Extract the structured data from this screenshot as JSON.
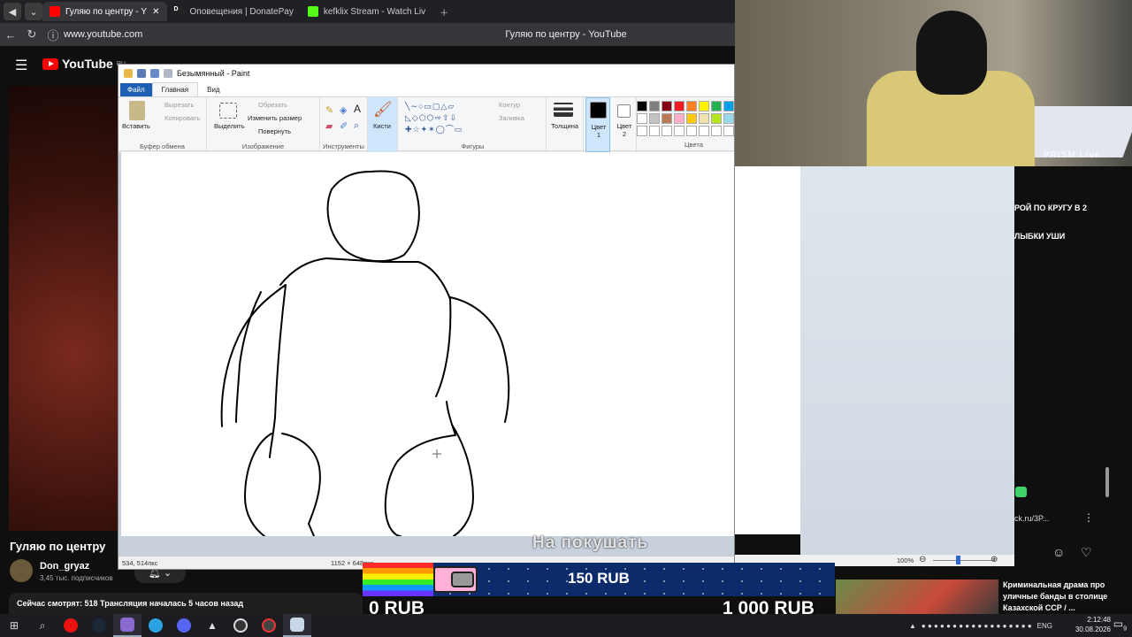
{
  "browser": {
    "tabs": [
      {
        "label": "Гуляю по центру - Y",
        "active": true
      },
      {
        "label": "Оповещения | DonatePay",
        "active": false
      },
      {
        "label": "kefklix Stream - Watch Liv",
        "active": false
      }
    ],
    "url": "www.youtube.com",
    "page_title": "Гуляю по центру - YouTube"
  },
  "youtube": {
    "logo_text": "YouTube",
    "region": "RU",
    "video_title": "Гуляю по центру",
    "channel": "Don_gryaz",
    "subscribers": "3,45 тыс. подписчиков",
    "stats_line": "Сейчас смотрят: 518  Трансляция началась 5 часов назад",
    "chat": {
      "line1": "РОЙ ПО КРУГУ В 2",
      "line2": "ЛЫБКИ УШИ",
      "link": "ck.ru/3P..."
    },
    "recommended": {
      "title": "Криминальная драма про уличные банды в столице Казахской ССР / ..."
    }
  },
  "webcam": {
    "label": "PRISM Live"
  },
  "paint": {
    "title": "Безымянный - Paint",
    "menu": {
      "file": "Файл",
      "home": "Главная",
      "view": "Вид"
    },
    "clipboard": {
      "paste": "Вставить",
      "cut": "Вырезать",
      "copy": "Копировать",
      "label": "Буфер обмена"
    },
    "image": {
      "select": "Выделить",
      "crop": "Обрезать",
      "resize": "Изменить размер",
      "rotate": "Повернуть",
      "label": "Изображение"
    },
    "tools": {
      "label": "Инструменты"
    },
    "brushes": {
      "label": "Кисти"
    },
    "shapes": {
      "outline": "Контур",
      "fill": "Заливка",
      "label": "Фигуры"
    },
    "size": {
      "label": "Толщина"
    },
    "color1": {
      "label": "Цвет 1"
    },
    "color2": {
      "label": "Цвет 2"
    },
    "colors": {
      "label": "Цвета"
    },
    "status": {
      "position": "534, 514пкс",
      "canvas_size": "1152 × 648пкс",
      "zoom": "100%"
    },
    "palette": [
      "#000000",
      "#7f7f7f",
      "#880015",
      "#ed1c24",
      "#ff7f27",
      "#fff200",
      "#22b14c",
      "#00a2e8",
      "#ffffff",
      "#c3c3c3",
      "#b97a57",
      "#ffaec9",
      "#ffc90e",
      "#efe4b0",
      "#b5e61d",
      "#99d9ea",
      "#ffffff",
      "#ffffff",
      "#ffffff",
      "#ffffff",
      "#ffffff",
      "#ffffff",
      "#ffffff",
      "#ffffff"
    ]
  },
  "donation": {
    "caption": "На покушать",
    "current": "150 RUB",
    "min": "0 RUB",
    "max": "1 000 RUB",
    "progress_fraction": 0.15
  },
  "taskbar": {
    "lang": "ENG",
    "time": "2:12:48",
    "date": "30.08.2026",
    "notifications": "9"
  }
}
